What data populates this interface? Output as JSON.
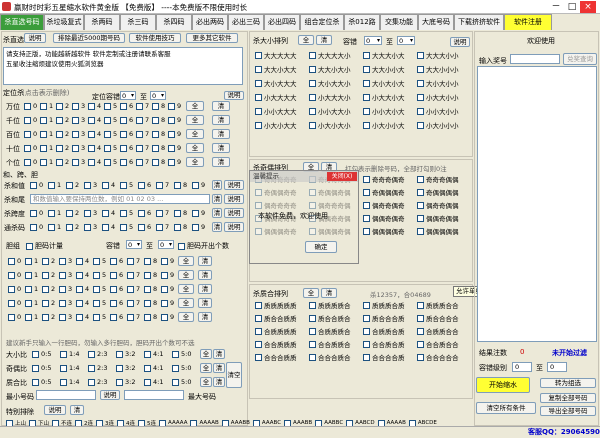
{
  "window": {
    "title": "赢财时时彩五星缩水软件黄金版     【免费版】 ----本免费版不限使用时长",
    "min": "－",
    "max": "□",
    "close": "×"
  },
  "tabs": [
    "杀直选号码",
    "杀垃圾复式",
    "杀两码",
    "杀三码",
    "杀四码",
    "必出两码",
    "必出三码",
    "必出四码",
    "组合定位杀",
    "杀012路",
    "交集功能",
    "大底号码",
    "下载挤挤软件",
    "软件注册"
  ],
  "left": {
    "header": {
      "label": "杀直选",
      "explain": "说明",
      "b1": "排除最近5000期号码",
      "b2": "软件使用技巧",
      "b3": "更多其它软件"
    },
    "notes": [
      "请支持正版，功能越新越软件       软件定制或注册请联系客服",
      "五星收注缩烦建议使用火狐浏览器"
    ],
    "dingwei": {
      "title": "定位杀",
      "hint": "(点击表示删除)",
      "gate": "定位容错",
      "v0": "0",
      "to": "至",
      "v1": "0",
      "rows": [
        "万位",
        "千位",
        "百位",
        "十位",
        "个位"
      ],
      "all": "全",
      "clear": "清"
    },
    "he": {
      "title": "和、跨、胆",
      "rows": [
        "杀和值",
        "杀和尾",
        "杀跨度",
        "通杀码"
      ],
      "explain": "说明",
      "placeholder": "和数值输入要保持两位数，例如 01 02 03 ..."
    },
    "danma": {
      "title": "胆组",
      "cnt": "胆码计量",
      "gate": "容错",
      "v0": "0",
      "to": "至",
      "v1": "0",
      "hint": "胆码开出个数",
      "all": "全",
      "clear": "清"
    },
    "ratio": {
      "title": "建议新手只输入一行胆码，勿输入多行胆码，胆码开出个数可不选",
      "rows": [
        "大小比",
        "奇偶比",
        "质合比"
      ],
      "opts": [
        "0:5",
        "1:4",
        "2:3",
        "3:2",
        "4:1",
        "5:0"
      ],
      "all": "全",
      "clear": "清",
      "clear2": "清空"
    },
    "minmax": {
      "min": "最小号码",
      "max": "最大号码",
      "explain": "说明"
    },
    "special": {
      "title": "特别排除",
      "explain": "说明",
      "clear": "清",
      "items": [
        "上山",
        "下山",
        "不连",
        "2连",
        "3连",
        "4连",
        "5连",
        "AAAAA",
        "AAAAB",
        "AAABB",
        "AAABC",
        "AAABB",
        "AABBC",
        "AABCD",
        "AAAAB",
        "ABCDE"
      ]
    }
  },
  "mid": {
    "daxiao": {
      "title": "杀大小排列",
      "all": "全",
      "clear": "清",
      "gate": "容错",
      "v0": "0",
      "to": "至",
      "v1": "0",
      "explain": "说明",
      "items": [
        "大大大大大",
        "大大大大小",
        "大大大小大",
        "大大大小小",
        "大大小大大",
        "大大小大小",
        "大大小小大",
        "大大小小小",
        "大小大大大",
        "大小大大小",
        "大小大小大",
        "大小大小小",
        "小大大大大",
        "小大大大小",
        "小大大小大",
        "小大大小小",
        "小小大大大",
        "小小大大小",
        "小小大小大",
        "小小大小小",
        "小大小大大",
        "小大小大小",
        "小大小小大",
        "小大小小小"
      ]
    },
    "jiou": {
      "title": "杀奇偶排列",
      "all": "全",
      "clear": "清",
      "hint": "打勾表示删除号码，全部打勾则0注",
      "items": [
        "奇奇奇奇奇",
        "奇奇奇奇偶",
        "奇奇奇偶奇",
        "奇奇奇偶偶",
        "奇偶偶奇奇",
        "奇偶偶奇偶",
        "奇偶偶偶奇",
        "奇偶偶偶偶",
        "偶奇奇奇奇",
        "偶奇奇奇偶",
        "偶奇奇偶奇",
        "偶奇奇偶偶",
        "偶偶奇奇奇",
        "偶偶奇奇偶",
        "偶偶奇偶奇",
        "偶偶奇偶偶",
        "偶偶偶奇奇",
        "偶偶偶奇偶",
        "偶偶偶偶奇",
        "偶偶偶偶偶"
      ]
    },
    "zhihe": {
      "title": "杀质合排列",
      "all": "全",
      "clear": "清",
      "count": "杀12357，合04689",
      "items": [
        "质质质质质",
        "质质质质合",
        "质质质合质",
        "质质质合合",
        "质合合质质",
        "质合合质合",
        "质合合合质",
        "质合合合合",
        "合质质质质",
        "合质质质合",
        "合质质合质",
        "合质质合合",
        "合合质质质",
        "合合质质合",
        "合合质合质",
        "合合质合合",
        "合合合质质",
        "合合合质合",
        "合合合合质",
        "合合合合合"
      ]
    },
    "tip": "允许单线程直接点击下载"
  },
  "right": {
    "welcome": "欢迎使用",
    "search_label": "输入奖号",
    "search_btn": "兑奖查询",
    "result_label": "结果注数",
    "result_val": "0",
    "status": "未开始过滤",
    "rongcuo": "容错级别",
    "rc0": "0",
    "to": "至",
    "rc1": "0",
    "start": "开始缩水",
    "convert": "转为组选",
    "clear_all": "清空所有条件",
    "copy": "复制全部号码",
    "export": "导出全部号码",
    "qq": "客服QQ：2906459031"
  },
  "dialog": {
    "caption": "温馨提示",
    "close": "关闭(X)",
    "msg": "本软件免费，欢迎使用",
    "ok": "确定"
  },
  "nums": [
    "0",
    "1",
    "2",
    "3",
    "4",
    "5",
    "6",
    "7",
    "8",
    "9"
  ]
}
